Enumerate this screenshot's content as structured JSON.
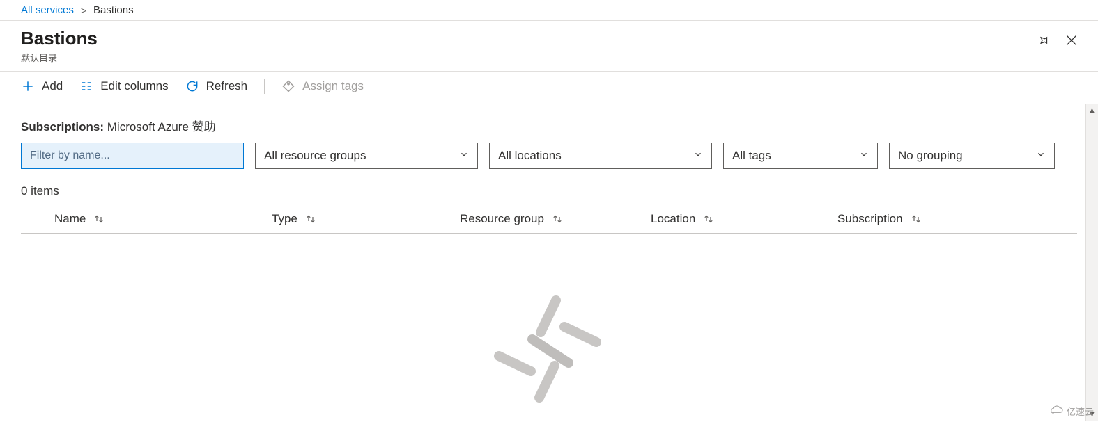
{
  "breadcrumb": {
    "root": "All services",
    "current": "Bastions"
  },
  "header": {
    "title": "Bastions",
    "subtitle": "默认目录"
  },
  "toolbar": {
    "add": "Add",
    "edit_columns": "Edit columns",
    "refresh": "Refresh",
    "assign_tags": "Assign tags"
  },
  "subscriptions": {
    "label": "Subscriptions:",
    "value": "Microsoft Azure 赞助"
  },
  "filters": {
    "name_placeholder": "Filter by name...",
    "resource_groups": "All resource groups",
    "locations": "All locations",
    "tags": "All tags",
    "grouping": "No grouping"
  },
  "items_count": "0 items",
  "columns": {
    "name": "Name",
    "type": "Type",
    "resource_group": "Resource group",
    "location": "Location",
    "subscription": "Subscription"
  },
  "watermark": "亿速云"
}
